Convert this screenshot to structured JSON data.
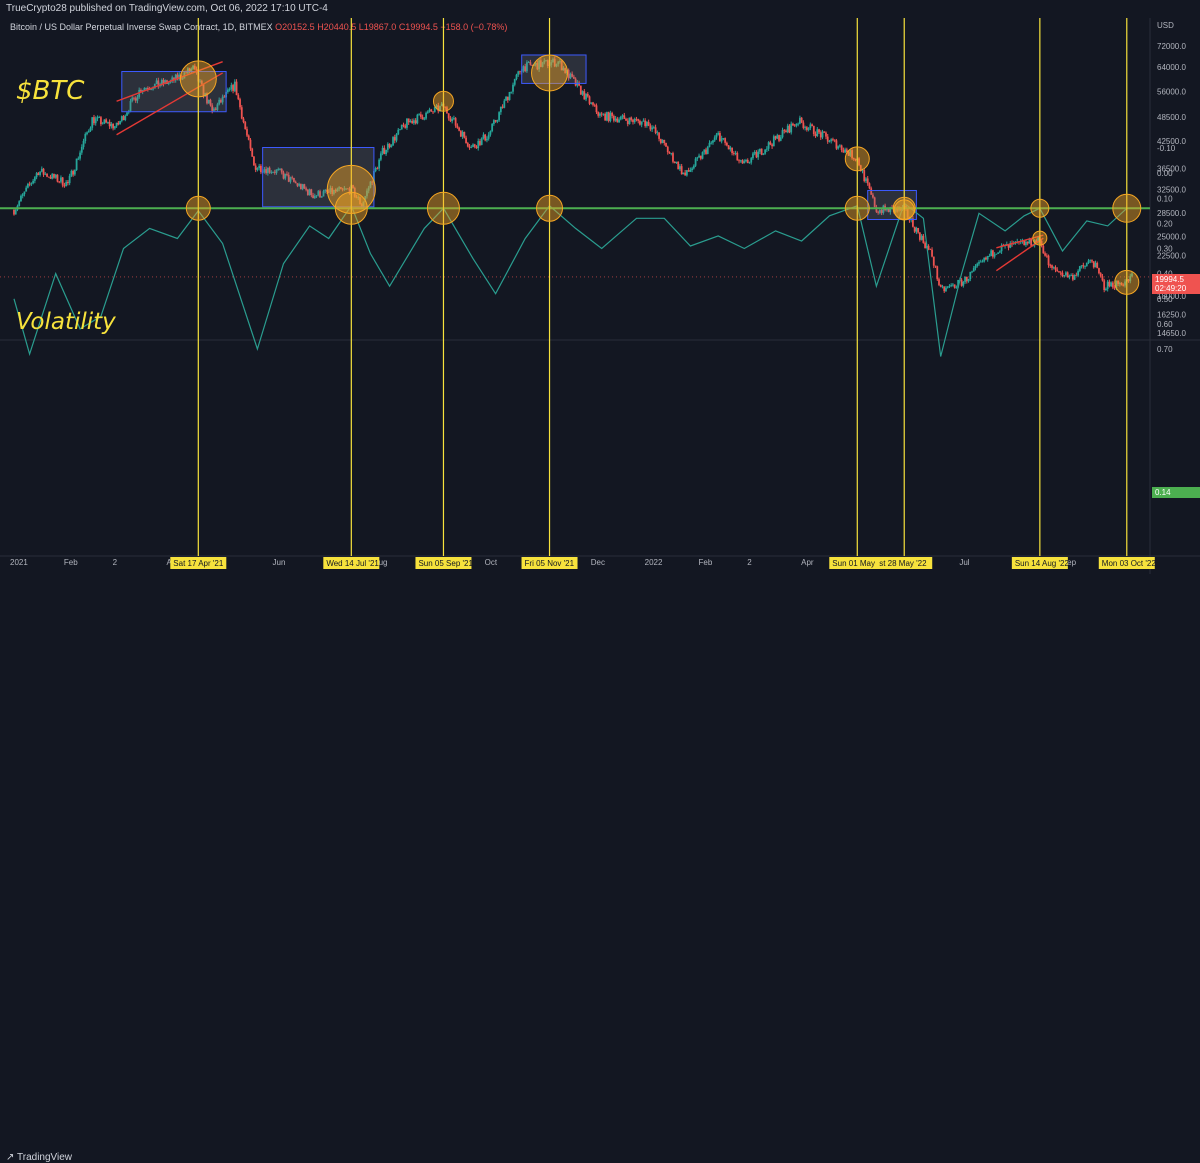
{
  "header": {
    "publisher": "TrueCrypto28 published on TradingView.com, Oct 06, 2022 17:10 UTC-4",
    "symbol": "Bitcoin / US Dollar Perpetual Inverse Swap Contract, 1D, BITMEX",
    "ohlc": {
      "o": "O20152.5",
      "h": "H20440.5",
      "l": "L19867.0",
      "c": "C19994.5",
      "chg": "−158.0 (−0.78%)"
    }
  },
  "annotations": {
    "btc_label": "$BTC",
    "volatility_label": "Volatility"
  },
  "footer": {
    "logo": "TradingView"
  },
  "colors": {
    "background": "#131722",
    "up": "#26a69a",
    "down": "#ef5350",
    "highlight_line": "#f7e23c",
    "volatility_line": "#2a9d8f",
    "threshold_line": "#4caf50",
    "box": "#3d5afe",
    "circle": "#f5a623",
    "wedge": "#e53935"
  },
  "chart_data": [
    {
      "type": "candlestick",
      "title": "Bitcoin / US Dollar Perpetual Inverse Swap Contract, 1D, BITMEX",
      "x_axis": [
        "2021",
        "Feb",
        "2",
        "Apr",
        "Jun",
        "Aug",
        "Oct",
        "Dec",
        "2022",
        "Feb",
        "2",
        "Apr",
        "Jul",
        "Sep"
      ],
      "y_scale": "log",
      "y_ticks": [
        14650.0,
        16250.0,
        18000.0,
        20000.0,
        22500.0,
        25000.0,
        28500.0,
        32500.0,
        36500.0,
        42500.0,
        48500.0,
        56000.0,
        64000.0,
        72000.0
      ],
      "y_unit": "USD",
      "last_price": "19994.5",
      "countdown": "02:49:20",
      "series": [
        {
          "x": "2021-01-01",
          "close": 29000
        },
        {
          "x": "2021-01-15",
          "close": 36000
        },
        {
          "x": "2021-02-01",
          "close": 33500
        },
        {
          "x": "2021-02-15",
          "close": 48000
        },
        {
          "x": "2021-03-01",
          "close": 46000
        },
        {
          "x": "2021-03-15",
          "close": 57000
        },
        {
          "x": "2021-04-01",
          "close": 59000
        },
        {
          "x": "2021-04-14",
          "close": 63500
        },
        {
          "x": "2021-04-25",
          "close": 50000
        },
        {
          "x": "2021-05-08",
          "close": 58000
        },
        {
          "x": "2021-05-19",
          "close": 37000
        },
        {
          "x": "2021-06-01",
          "close": 36000
        },
        {
          "x": "2021-06-22",
          "close": 31500
        },
        {
          "x": "2021-07-14",
          "close": 32500
        },
        {
          "x": "2021-07-20",
          "close": 29800
        },
        {
          "x": "2021-08-01",
          "close": 40000
        },
        {
          "x": "2021-08-15",
          "close": 47000
        },
        {
          "x": "2021-09-05",
          "close": 51500
        },
        {
          "x": "2021-09-21",
          "close": 41000
        },
        {
          "x": "2021-10-01",
          "close": 44000
        },
        {
          "x": "2021-10-20",
          "close": 64000
        },
        {
          "x": "2021-11-10",
          "close": 66000
        },
        {
          "x": "2021-11-26",
          "close": 54000
        },
        {
          "x": "2021-12-04",
          "close": 49000
        },
        {
          "x": "2022-01-01",
          "close": 47000
        },
        {
          "x": "2022-01-22",
          "close": 35000
        },
        {
          "x": "2022-02-10",
          "close": 44000
        },
        {
          "x": "2022-02-24",
          "close": 37000
        },
        {
          "x": "2022-03-28",
          "close": 47500
        },
        {
          "x": "2022-04-20",
          "close": 41500
        },
        {
          "x": "2022-05-01",
          "close": 38500
        },
        {
          "x": "2022-05-12",
          "close": 29000
        },
        {
          "x": "2022-05-28",
          "close": 29000
        },
        {
          "x": "2022-06-13",
          "close": 22500
        },
        {
          "x": "2022-06-18",
          "close": 18500
        },
        {
          "x": "2022-07-01",
          "close": 19500
        },
        {
          "x": "2022-07-20",
          "close": 23300
        },
        {
          "x": "2022-08-14",
          "close": 24500
        },
        {
          "x": "2022-08-20",
          "close": 21000
        },
        {
          "x": "2022-09-01",
          "close": 20000
        },
        {
          "x": "2022-09-13",
          "close": 22000
        },
        {
          "x": "2022-09-20",
          "close": 19000
        },
        {
          "x": "2022-10-03",
          "close": 19500
        },
        {
          "x": "2022-10-06",
          "close": 19994.5
        }
      ]
    },
    {
      "type": "line",
      "title": "Volatility",
      "y_range": [
        -0.1,
        0.7
      ],
      "y_ticks": [
        -0.1,
        0.0,
        0.1,
        0.2,
        0.3,
        0.4,
        0.5,
        0.6,
        0.7
      ],
      "current_value": "0.14",
      "threshold": 0.14,
      "series": [
        {
          "x": "2021-01-01",
          "y": 0.5
        },
        {
          "x": "2021-01-10",
          "y": 0.72
        },
        {
          "x": "2021-01-25",
          "y": 0.4
        },
        {
          "x": "2021-02-08",
          "y": 0.62
        },
        {
          "x": "2021-02-20",
          "y": 0.57
        },
        {
          "x": "2021-03-05",
          "y": 0.3
        },
        {
          "x": "2021-03-20",
          "y": 0.22
        },
        {
          "x": "2021-04-05",
          "y": 0.26
        },
        {
          "x": "2021-04-17",
          "y": 0.15
        },
        {
          "x": "2021-05-01",
          "y": 0.28
        },
        {
          "x": "2021-05-21",
          "y": 0.7
        },
        {
          "x": "2021-06-05",
          "y": 0.36
        },
        {
          "x": "2021-06-20",
          "y": 0.21
        },
        {
          "x": "2021-07-01",
          "y": 0.26
        },
        {
          "x": "2021-07-14",
          "y": 0.13
        },
        {
          "x": "2021-07-25",
          "y": 0.32
        },
        {
          "x": "2021-08-05",
          "y": 0.45
        },
        {
          "x": "2021-08-25",
          "y": 0.22
        },
        {
          "x": "2021-09-05",
          "y": 0.14
        },
        {
          "x": "2021-09-22",
          "y": 0.34
        },
        {
          "x": "2021-10-05",
          "y": 0.48
        },
        {
          "x": "2021-10-22",
          "y": 0.26
        },
        {
          "x": "2021-11-05",
          "y": 0.13
        },
        {
          "x": "2021-11-20",
          "y": 0.22
        },
        {
          "x": "2021-12-05",
          "y": 0.3
        },
        {
          "x": "2021-12-25",
          "y": 0.18
        },
        {
          "x": "2022-01-10",
          "y": 0.18
        },
        {
          "x": "2022-01-25",
          "y": 0.29
        },
        {
          "x": "2022-02-10",
          "y": 0.25
        },
        {
          "x": "2022-02-25",
          "y": 0.3
        },
        {
          "x": "2022-03-15",
          "y": 0.23
        },
        {
          "x": "2022-03-30",
          "y": 0.27
        },
        {
          "x": "2022-04-15",
          "y": 0.17
        },
        {
          "x": "2022-05-01",
          "y": 0.13
        },
        {
          "x": "2022-05-12",
          "y": 0.45
        },
        {
          "x": "2022-05-28",
          "y": 0.12
        },
        {
          "x": "2022-06-08",
          "y": 0.18
        },
        {
          "x": "2022-06-18",
          "y": 0.73
        },
        {
          "x": "2022-06-30",
          "y": 0.4
        },
        {
          "x": "2022-07-10",
          "y": 0.16
        },
        {
          "x": "2022-07-25",
          "y": 0.23
        },
        {
          "x": "2022-08-05",
          "y": 0.17
        },
        {
          "x": "2022-08-14",
          "y": 0.14
        },
        {
          "x": "2022-08-27",
          "y": 0.31
        },
        {
          "x": "2022-09-10",
          "y": 0.19
        },
        {
          "x": "2022-09-22",
          "y": 0.21
        },
        {
          "x": "2022-10-03",
          "y": 0.14
        },
        {
          "x": "2022-10-06",
          "y": 0.14
        }
      ]
    }
  ],
  "event_dates": [
    {
      "date": "2021-04-17",
      "label": "Sat 17 Apr '21"
    },
    {
      "date": "2021-07-14",
      "label": "Wed 14 Jul '21"
    },
    {
      "date": "2021-09-05",
      "label": "Sun 05 Sep '21"
    },
    {
      "date": "2021-11-05",
      "label": "Fri 05 Nov '21"
    },
    {
      "date": "2022-05-01",
      "label": "Sun 01 May '22"
    },
    {
      "date": "2022-05-28",
      "label": "st 28 May '22"
    },
    {
      "date": "2022-08-14",
      "label": "Sun 14 Aug '22"
    },
    {
      "date": "2022-10-03",
      "label": "Mon 03 Oct '22"
    }
  ],
  "x_axis_labels": [
    {
      "date": "2021-01-01",
      "label": "2021"
    },
    {
      "date": "2021-02-01",
      "label": "Feb"
    },
    {
      "date": "2021-03-01",
      "label": "2"
    },
    {
      "date": "2021-04-01",
      "label": "A"
    },
    {
      "date": "2021-06-01",
      "label": "Jun"
    },
    {
      "date": "2021-08-01",
      "label": "ug"
    },
    {
      "date": "2021-10-01",
      "label": "Oct"
    },
    {
      "date": "2021-12-01",
      "label": "Dec"
    },
    {
      "date": "2022-01-01",
      "label": "2022"
    },
    {
      "date": "2022-02-01",
      "label": "Feb"
    },
    {
      "date": "2022-03-01",
      "label": "2"
    },
    {
      "date": "2022-04-01",
      "label": "Apr"
    },
    {
      "date": "2022-07-01",
      "label": "Jul"
    },
    {
      "date": "2022-09-01",
      "label": "ep"
    }
  ],
  "consolidation_boxes": [
    {
      "start": "2021-03-04",
      "end": "2021-05-03",
      "low": 50000,
      "high": 62500
    },
    {
      "start": "2021-05-24",
      "end": "2021-07-27",
      "low": 29500,
      "high": 41000
    },
    {
      "start": "2021-10-20",
      "end": "2021-11-26",
      "low": 58500,
      "high": 68500
    },
    {
      "start": "2022-05-07",
      "end": "2022-06-04",
      "low": 27500,
      "high": 32300
    }
  ],
  "price_circles": [
    {
      "date": "2021-04-17",
      "price": 60000
    },
    {
      "date": "2021-07-14",
      "price": 32500
    },
    {
      "date": "2021-09-05",
      "price": 53000
    },
    {
      "date": "2021-11-05",
      "price": 62000
    },
    {
      "date": "2022-05-01",
      "price": 38500
    },
    {
      "date": "2022-05-28",
      "price": 29000
    },
    {
      "date": "2022-08-14",
      "price": 24800
    },
    {
      "date": "2022-10-03",
      "price": 19400
    }
  ],
  "wedges": [
    {
      "start": "2021-03-01",
      "end": "2021-05-01",
      "upper": [
        53000,
        66000
      ],
      "lower": [
        44000,
        62000
      ]
    },
    {
      "start": "2022-07-20",
      "end": "2022-08-16",
      "upper": [
        23500,
        25200
      ],
      "lower": [
        20700,
        24800
      ]
    }
  ]
}
